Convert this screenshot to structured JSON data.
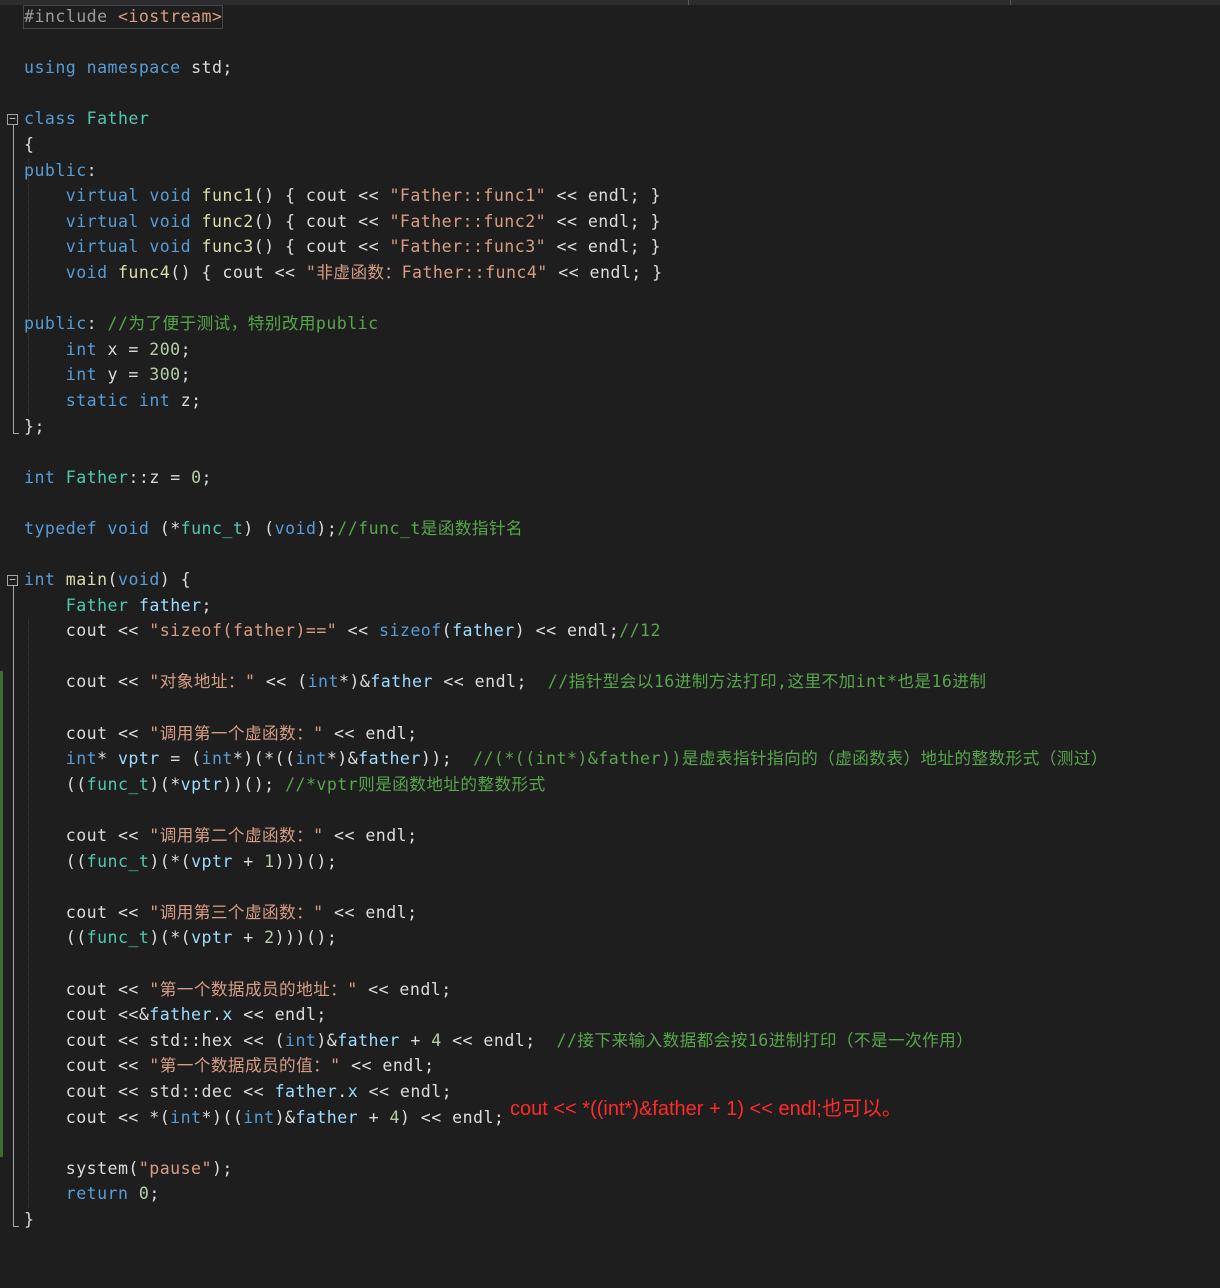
{
  "editor": {
    "lines": [
      [
        [
          "preproc",
          "#include "
        ],
        [
          "string",
          "<iostream>"
        ]
      ],
      [],
      [
        [
          "keyword",
          "using"
        ],
        [
          "plain",
          " "
        ],
        [
          "keyword",
          "namespace"
        ],
        [
          "plain",
          " std;"
        ]
      ],
      [],
      [
        [
          "keyword",
          "class"
        ],
        [
          "plain",
          " "
        ],
        [
          "type",
          "Father"
        ]
      ],
      [
        [
          "plain",
          "{"
        ]
      ],
      [
        [
          "keyword",
          "public"
        ],
        [
          "plain",
          ":"
        ]
      ],
      [
        [
          "plain",
          "    "
        ],
        [
          "keyword",
          "virtual"
        ],
        [
          "plain",
          " "
        ],
        [
          "keyword",
          "void"
        ],
        [
          "plain",
          " "
        ],
        [
          "func",
          "func1"
        ],
        [
          "plain",
          "() { cout << "
        ],
        [
          "string",
          "\"Father::func1\""
        ],
        [
          "plain",
          " << endl; }"
        ]
      ],
      [
        [
          "plain",
          "    "
        ],
        [
          "keyword",
          "virtual"
        ],
        [
          "plain",
          " "
        ],
        [
          "keyword",
          "void"
        ],
        [
          "plain",
          " "
        ],
        [
          "func",
          "func2"
        ],
        [
          "plain",
          "() { cout << "
        ],
        [
          "string",
          "\"Father::func2\""
        ],
        [
          "plain",
          " << endl; }"
        ]
      ],
      [
        [
          "plain",
          "    "
        ],
        [
          "keyword",
          "virtual"
        ],
        [
          "plain",
          " "
        ],
        [
          "keyword",
          "void"
        ],
        [
          "plain",
          " "
        ],
        [
          "func",
          "func3"
        ],
        [
          "plain",
          "() { cout << "
        ],
        [
          "string",
          "\"Father::func3\""
        ],
        [
          "plain",
          " << endl; }"
        ]
      ],
      [
        [
          "plain",
          "    "
        ],
        [
          "keyword",
          "void"
        ],
        [
          "plain",
          " "
        ],
        [
          "func",
          "func4"
        ],
        [
          "plain",
          "() { cout << "
        ],
        [
          "string",
          "\"非虚函数：Father::func4\""
        ],
        [
          "plain",
          " << endl; }"
        ]
      ],
      [],
      [
        [
          "keyword",
          "public"
        ],
        [
          "plain",
          ": "
        ],
        [
          "comment",
          "//为了便于测试，特别改用public"
        ]
      ],
      [
        [
          "plain",
          "    "
        ],
        [
          "keyword",
          "int"
        ],
        [
          "plain",
          " x = "
        ],
        [
          "number",
          "200"
        ],
        [
          "plain",
          ";"
        ]
      ],
      [
        [
          "plain",
          "    "
        ],
        [
          "keyword",
          "int"
        ],
        [
          "plain",
          " y = "
        ],
        [
          "number",
          "300"
        ],
        [
          "plain",
          ";"
        ]
      ],
      [
        [
          "plain",
          "    "
        ],
        [
          "keyword",
          "static"
        ],
        [
          "plain",
          " "
        ],
        [
          "keyword",
          "int"
        ],
        [
          "plain",
          " z;"
        ]
      ],
      [
        [
          "plain",
          "};"
        ]
      ],
      [],
      [
        [
          "keyword",
          "int"
        ],
        [
          "plain",
          " "
        ],
        [
          "type",
          "Father"
        ],
        [
          "plain",
          "::z = "
        ],
        [
          "number",
          "0"
        ],
        [
          "plain",
          ";"
        ]
      ],
      [],
      [
        [
          "keyword",
          "typedef"
        ],
        [
          "plain",
          " "
        ],
        [
          "keyword",
          "void"
        ],
        [
          "plain",
          " (*"
        ],
        [
          "type",
          "func_t"
        ],
        [
          "plain",
          ") ("
        ],
        [
          "keyword",
          "void"
        ],
        [
          "plain",
          ");"
        ],
        [
          "comment",
          "//func_t是函数指针名"
        ]
      ],
      [],
      [
        [
          "keyword",
          "int"
        ],
        [
          "plain",
          " "
        ],
        [
          "func",
          "main"
        ],
        [
          "plain",
          "("
        ],
        [
          "keyword",
          "void"
        ],
        [
          "plain",
          ") {"
        ]
      ],
      [
        [
          "plain",
          "    "
        ],
        [
          "type",
          "Father"
        ],
        [
          "plain",
          " "
        ],
        [
          "var",
          "father"
        ],
        [
          "plain",
          ";"
        ]
      ],
      [
        [
          "plain",
          "    cout << "
        ],
        [
          "string",
          "\"sizeof(father)==\""
        ],
        [
          "plain",
          " << "
        ],
        [
          "keyword",
          "sizeof"
        ],
        [
          "plain",
          "("
        ],
        [
          "var",
          "father"
        ],
        [
          "plain",
          ") << endl;"
        ],
        [
          "comment",
          "//12"
        ]
      ],
      [],
      [
        [
          "plain",
          "    cout << "
        ],
        [
          "string",
          "\"对象地址：\""
        ],
        [
          "plain",
          " << ("
        ],
        [
          "keyword",
          "int"
        ],
        [
          "plain",
          "*)&"
        ],
        [
          "var",
          "father"
        ],
        [
          "plain",
          " << endl;  "
        ],
        [
          "comment",
          "//指针型会以16进制方法打印,这里不加int*也是16进制"
        ]
      ],
      [],
      [
        [
          "plain",
          "    cout << "
        ],
        [
          "string",
          "\"调用第一个虚函数：\""
        ],
        [
          "plain",
          " << endl;"
        ]
      ],
      [
        [
          "plain",
          "    "
        ],
        [
          "keyword",
          "int"
        ],
        [
          "plain",
          "* "
        ],
        [
          "var",
          "vptr"
        ],
        [
          "plain",
          " = ("
        ],
        [
          "keyword",
          "int"
        ],
        [
          "plain",
          "*)(*(("
        ],
        [
          "keyword",
          "int"
        ],
        [
          "plain",
          "*)&"
        ],
        [
          "var",
          "father"
        ],
        [
          "plain",
          "));  "
        ],
        [
          "comment",
          "//(*((int*)&father))是虚表指针指向的（虚函数表）地址的整数形式（测过）"
        ]
      ],
      [
        [
          "plain",
          "    (("
        ],
        [
          "type",
          "func_t"
        ],
        [
          "plain",
          ")(*"
        ],
        [
          "var",
          "vptr"
        ],
        [
          "plain",
          "))(); "
        ],
        [
          "comment",
          "//*vptr则是函数地址的整数形式"
        ]
      ],
      [],
      [
        [
          "plain",
          "    cout << "
        ],
        [
          "string",
          "\"调用第二个虚函数：\""
        ],
        [
          "plain",
          " << endl;"
        ]
      ],
      [
        [
          "plain",
          "    (("
        ],
        [
          "type",
          "func_t"
        ],
        [
          "plain",
          ")(*("
        ],
        [
          "var",
          "vptr"
        ],
        [
          "plain",
          " + "
        ],
        [
          "number",
          "1"
        ],
        [
          "plain",
          ")))();"
        ]
      ],
      [],
      [
        [
          "plain",
          "    cout << "
        ],
        [
          "string",
          "\"调用第三个虚函数：\""
        ],
        [
          "plain",
          " << endl;"
        ]
      ],
      [
        [
          "plain",
          "    (("
        ],
        [
          "type",
          "func_t"
        ],
        [
          "plain",
          ")(*("
        ],
        [
          "var",
          "vptr"
        ],
        [
          "plain",
          " + "
        ],
        [
          "number",
          "2"
        ],
        [
          "plain",
          ")))();"
        ]
      ],
      [],
      [
        [
          "plain",
          "    cout << "
        ],
        [
          "string",
          "\"第一个数据成员的地址：\""
        ],
        [
          "plain",
          " << endl;"
        ]
      ],
      [
        [
          "plain",
          "    cout <<&"
        ],
        [
          "var",
          "father"
        ],
        [
          "plain",
          "."
        ],
        [
          "var",
          "x"
        ],
        [
          "plain",
          " << endl;"
        ]
      ],
      [
        [
          "plain",
          "    cout << std::hex << ("
        ],
        [
          "keyword",
          "int"
        ],
        [
          "plain",
          ")&"
        ],
        [
          "var",
          "father"
        ],
        [
          "plain",
          " + "
        ],
        [
          "number",
          "4"
        ],
        [
          "plain",
          " << endl;  "
        ],
        [
          "comment",
          "//接下来输入数据都会按16进制打印（不是一次作用）"
        ]
      ],
      [
        [
          "plain",
          "    cout << "
        ],
        [
          "string",
          "\"第一个数据成员的值：\""
        ],
        [
          "plain",
          " << endl;"
        ]
      ],
      [
        [
          "plain",
          "    cout << std::dec << "
        ],
        [
          "var",
          "father"
        ],
        [
          "plain",
          "."
        ],
        [
          "var",
          "x"
        ],
        [
          "plain",
          " << endl;"
        ]
      ],
      [
        [
          "plain",
          "    cout << *("
        ],
        [
          "keyword",
          "int"
        ],
        [
          "plain",
          "*)(("
        ],
        [
          "keyword",
          "int"
        ],
        [
          "plain",
          ")&"
        ],
        [
          "var",
          "father"
        ],
        [
          "plain",
          " + "
        ],
        [
          "number",
          "4"
        ],
        [
          "plain",
          ") << endl;"
        ]
      ],
      [],
      [
        [
          "plain",
          "    system("
        ],
        [
          "string",
          "\"pause\""
        ],
        [
          "plain",
          ");"
        ]
      ],
      [
        [
          "plain",
          "    "
        ],
        [
          "keyword",
          "return"
        ],
        [
          "plain",
          " "
        ],
        [
          "number",
          "0"
        ],
        [
          "plain",
          ";"
        ]
      ],
      [
        [
          "plain",
          "}"
        ]
      ]
    ],
    "folds": [
      {
        "start": 4,
        "end": 16,
        "symbol": "−"
      },
      {
        "start": 22,
        "end": 47,
        "symbol": "−"
      }
    ],
    "changed_lines": [
      [
        26,
        44
      ]
    ]
  },
  "annotation": {
    "text": "cout << *((int*)&father + 1) << endl;也可以。",
    "color": "#ff2a2a"
  },
  "colors": {
    "background": "#1e1e1e",
    "keyword": "#569cd6",
    "type": "#4ec9b0",
    "string": "#d69d85",
    "comment": "#57a64a",
    "number": "#b5cea8",
    "function": "#dcdcaa",
    "variable": "#9cdcfe",
    "plain": "#dcdcdc"
  }
}
